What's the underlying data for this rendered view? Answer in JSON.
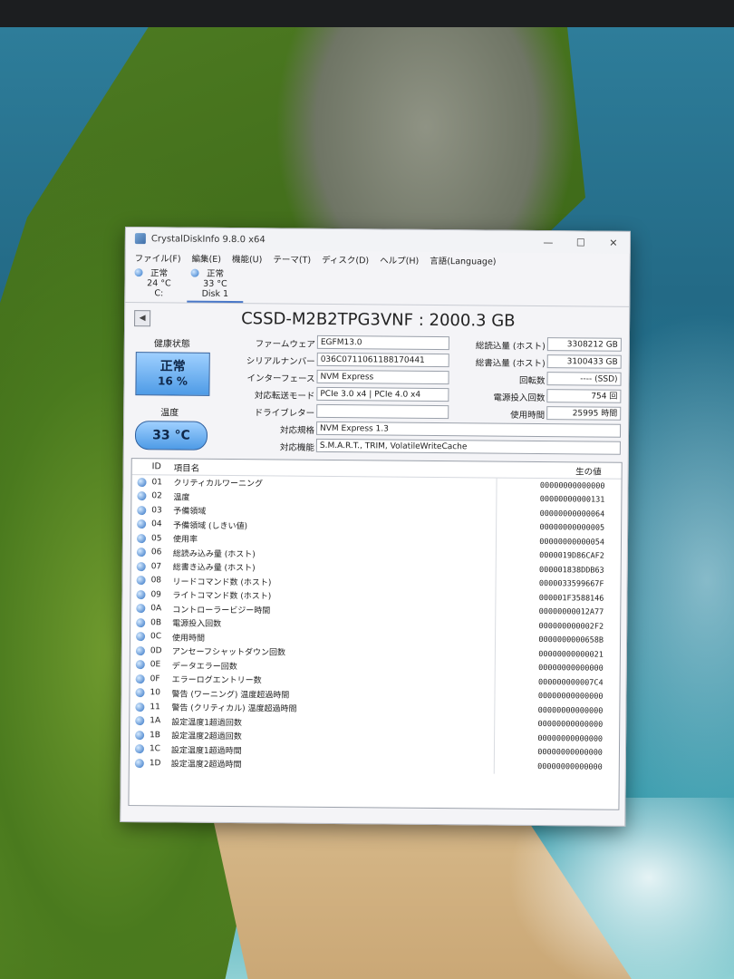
{
  "window": {
    "title": "CrystalDiskInfo 9.8.0 x64",
    "controls": {
      "minimize": "—",
      "maximize": "☐",
      "close": "✕"
    }
  },
  "menu": [
    "ファイル(F)",
    "編集(E)",
    "機能(U)",
    "テーマ(T)",
    "ディスク(D)",
    "ヘルプ(H)",
    "言語(Language)"
  ],
  "disks": [
    {
      "status": "正常",
      "temp": "24 °C",
      "name": "C:"
    },
    {
      "status": "正常",
      "temp": "33 °C",
      "name": "Disk 1"
    }
  ],
  "model": "CSSD-M2B2TPG3VNF : 2000.3 GB",
  "health": {
    "label": "健康状態",
    "status": "正常",
    "percent": "16 %"
  },
  "temperature": {
    "label": "温度",
    "value": "33 °C"
  },
  "left_fields": [
    {
      "label": "ファームウェア",
      "value": "EGFM13.0"
    },
    {
      "label": "シリアルナンバー",
      "value": "036C0711061188170441"
    },
    {
      "label": "インターフェース",
      "value": "NVM Express"
    },
    {
      "label": "対応転送モード",
      "value": "PCIe 3.0 x4 | PCIe 4.0 x4"
    },
    {
      "label": "ドライブレター",
      "value": ""
    }
  ],
  "right_fields": [
    {
      "label": "総読込量 (ホスト)",
      "value": "3308212 GB"
    },
    {
      "label": "総書込量 (ホスト)",
      "value": "3100433 GB"
    },
    {
      "label": "回転数",
      "value": "---- (SSD)"
    },
    {
      "label": "電源投入回数",
      "value": "754 回"
    },
    {
      "label": "使用時間",
      "value": "25995 時間"
    }
  ],
  "wide_fields": [
    {
      "label": "対応規格",
      "value": "NVM Express 1.3"
    },
    {
      "label": "対応機能",
      "value": "S.M.A.R.T., TRIM, VolatileWriteCache"
    }
  ],
  "smart": {
    "headers": {
      "id": "ID",
      "name": "項目名",
      "raw": "生の値"
    },
    "rows": [
      {
        "id": "01",
        "name": "クリティカルワーニング",
        "raw": "00000000000000"
      },
      {
        "id": "02",
        "name": "温度",
        "raw": "00000000000131"
      },
      {
        "id": "03",
        "name": "予備領域",
        "raw": "00000000000064"
      },
      {
        "id": "04",
        "name": "予備領域 (しきい値)",
        "raw": "00000000000005"
      },
      {
        "id": "05",
        "name": "使用率",
        "raw": "00000000000054"
      },
      {
        "id": "06",
        "name": "総読み込み量 (ホスト)",
        "raw": "0000019D86CAF2"
      },
      {
        "id": "07",
        "name": "総書き込み量 (ホスト)",
        "raw": "000001838DDB63"
      },
      {
        "id": "08",
        "name": "リードコマンド数 (ホスト)",
        "raw": "0000033599667F"
      },
      {
        "id": "09",
        "name": "ライトコマンド数 (ホスト)",
        "raw": "000001F3588146"
      },
      {
        "id": "0A",
        "name": "コントローラービジー時間",
        "raw": "00000000012A77"
      },
      {
        "id": "0B",
        "name": "電源投入回数",
        "raw": "000000000002F2"
      },
      {
        "id": "0C",
        "name": "使用時間",
        "raw": "0000000000658B"
      },
      {
        "id": "0D",
        "name": "アンセーフシャットダウン回数",
        "raw": "00000000000021"
      },
      {
        "id": "0E",
        "name": "データエラー回数",
        "raw": "00000000000000"
      },
      {
        "id": "0F",
        "name": "エラーログエントリー数",
        "raw": "000000000007C4"
      },
      {
        "id": "10",
        "name": "警告 (ワーニング) 温度超過時間",
        "raw": "00000000000000"
      },
      {
        "id": "11",
        "name": "警告 (クリティカル) 温度超過時間",
        "raw": "00000000000000"
      },
      {
        "id": "1A",
        "name": "設定温度1超過回数",
        "raw": "00000000000000"
      },
      {
        "id": "1B",
        "name": "設定温度2超過回数",
        "raw": "00000000000000"
      },
      {
        "id": "1C",
        "name": "設定温度1超過時間",
        "raw": "00000000000000"
      },
      {
        "id": "1D",
        "name": "設定温度2超過時間",
        "raw": "00000000000000"
      }
    ]
  }
}
